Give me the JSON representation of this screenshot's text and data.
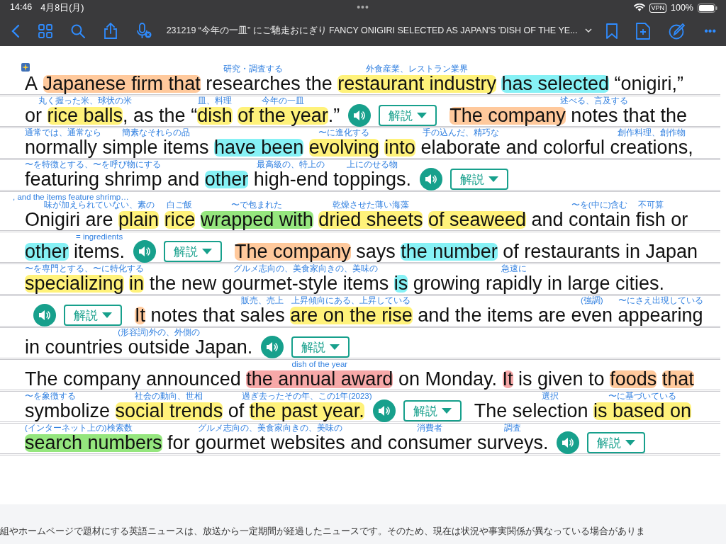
{
  "status_bar": {
    "time": "14:46",
    "date": "4月8日(月)",
    "dots": "•••",
    "vpn": "VPN",
    "battery": "100%"
  },
  "toolbar": {
    "title": "231219 “今年の一皿” にご馳走おにぎり FANCY ONIGIRI SELECTED AS JAPAN'S 'DISH OF THE YE...",
    "more": "•••"
  },
  "lines": [
    {
      "segments": [
        {
          "kind": "text",
          "text": "A "
        },
        {
          "kind": "text",
          "text": "Japanese firm that",
          "color": "#ffc99c"
        },
        {
          "kind": "text",
          "text": " researches",
          "gloss": "研究・調査する"
        },
        {
          "kind": "text",
          "text": " the "
        },
        {
          "kind": "text",
          "text": "restaurant industry",
          "color": "#fff27a",
          "gloss": "外食産業、レストラン業界"
        },
        {
          "kind": "text",
          "text": " has selected",
          "color": "#86f1f5"
        },
        {
          "kind": "text",
          "text": " “onigiri,”"
        }
      ]
    },
    {
      "segments": [
        {
          "kind": "text",
          "text": "or "
        },
        {
          "kind": "text",
          "text": "rice balls",
          "color": "#fff27a",
          "gloss": "丸く握った米、球状の米"
        },
        {
          "kind": "text",
          "text": ", as the “"
        },
        {
          "kind": "text",
          "text": "dish",
          "color": "#fff27a",
          "gloss": "皿、料理"
        },
        {
          "kind": "text",
          "text": " of the year",
          "color": "#fff27a",
          "gloss": "今年の一皿"
        },
        {
          "kind": "text",
          "text": ".”"
        },
        {
          "kind": "audio",
          "label": "解説"
        },
        {
          "kind": "text",
          "text": "The company",
          "color": "#ffc99c"
        },
        {
          "kind": "text",
          "text": " notes",
          "gloss": "述べる、言及する"
        },
        {
          "kind": "text",
          "text": " that the"
        }
      ]
    },
    {
      "segments": [
        {
          "kind": "text",
          "text": "normally",
          "gloss": "通常では、通常なら"
        },
        {
          "kind": "text",
          "text": " simple items",
          "gloss": "簡素なそれらの品"
        },
        {
          "kind": "text",
          "text": " have been",
          "color": "#86f1f5"
        },
        {
          "kind": "text",
          "text": " evolving",
          "color": "#fff27a",
          "gloss": "〜に進化する"
        },
        {
          "kind": "text",
          "text": " into",
          "color": "#fff27a"
        },
        {
          "kind": "text",
          "text": " elaborate",
          "gloss": "手の込んだ、精巧な"
        },
        {
          "kind": "text",
          "text": " and colorful "
        },
        {
          "kind": "text",
          "text": "creations,",
          "gloss": "創作料理、創作物"
        }
      ]
    },
    {
      "segments": [
        {
          "kind": "text",
          "text": "featuring",
          "gloss": "〜を特徴とする、〜を呼び物にする"
        },
        {
          "kind": "text",
          "text": " shrimp and "
        },
        {
          "kind": "text",
          "text": "other",
          "color": "#86f1f5"
        },
        {
          "kind": "text",
          "text": " high-end",
          "gloss": "最高級の、特上の"
        },
        {
          "kind": "text",
          "text": " toppings.",
          "gloss": "上にのせる物"
        },
        {
          "kind": "audio",
          "label": "解説"
        }
      ]
    },
    {
      "note": ", and the items feature shrimp…",
      "segments": [
        {
          "kind": "text",
          "text": "Onigiri "
        },
        {
          "kind": "text",
          "text": "are",
          "gloss": "味が加えられていない、素の"
        },
        {
          "kind": "text",
          "text": " plain",
          "color": "#fff27a"
        },
        {
          "kind": "text",
          "text": " rice",
          "color": "#fff27a",
          "gloss": "白ご飯"
        },
        {
          "kind": "text",
          "text": " wrapped with",
          "color": "#95e67e",
          "gloss": "〜で包まれた"
        },
        {
          "kind": "text",
          "text": " dried sheets",
          "color": "#fff27a",
          "gloss": "乾燥させた薄い海藻"
        },
        {
          "kind": "text",
          "text": " of seaweed",
          "color": "#fff27a"
        },
        {
          "kind": "text",
          "text": " and "
        },
        {
          "kind": "text",
          "text": "contain",
          "gloss": "〜を(中に)含む"
        },
        {
          "kind": "text",
          "text": " fish",
          "gloss": "不可算"
        },
        {
          "kind": "text",
          "text": " or"
        }
      ]
    },
    {
      "segments": [
        {
          "kind": "text",
          "text": "other",
          "color": "#86f1f5"
        },
        {
          "kind": "text",
          "text": " items.",
          "gloss": "= ingredients"
        },
        {
          "kind": "audio",
          "label": "解説"
        },
        {
          "kind": "text",
          "text": "The company",
          "color": "#ffc99c"
        },
        {
          "kind": "text",
          "text": " says "
        },
        {
          "kind": "text",
          "text": "the number",
          "color": "#86f1f5"
        },
        {
          "kind": "text",
          "text": " of restaurants in Japan"
        }
      ]
    },
    {
      "segments": [
        {
          "kind": "text",
          "text": "specializing",
          "color": "#fff27a",
          "gloss": "〜を専門とする、〜に特化する"
        },
        {
          "kind": "text",
          "text": " in",
          "color": "#fff27a"
        },
        {
          "kind": "text",
          "text": " the new "
        },
        {
          "kind": "text",
          "text": "gourmet-style items",
          "gloss": "グルメ志向の、美食家向きの、美味の"
        },
        {
          "kind": "text",
          "text": " is",
          "color": "#86f1f5"
        },
        {
          "kind": "text",
          "text": " growing "
        },
        {
          "kind": "text",
          "text": "rapidly",
          "gloss": "急速に"
        },
        {
          "kind": "text",
          "text": " in large cities."
        }
      ]
    },
    {
      "segments": [
        {
          "kind": "audio",
          "label": "解説"
        },
        {
          "kind": "text",
          "text": "It",
          "color": "#ffc99c"
        },
        {
          "kind": "text",
          "text": " notes that "
        },
        {
          "kind": "text",
          "text": "sales",
          "gloss": "販売、売上"
        },
        {
          "kind": "text",
          "text": " are on the rise",
          "color": "#fff27a",
          "gloss": "上昇傾向にある、上昇している"
        },
        {
          "kind": "text",
          "text": " and the items are "
        },
        {
          "kind": "text",
          "text": "even",
          "gloss": "(強調)"
        },
        {
          "kind": "text",
          "text": " appearing",
          "gloss": "〜にさえ出現している"
        }
      ]
    },
    {
      "segments": [
        {
          "kind": "text",
          "text": "in countries "
        },
        {
          "kind": "text",
          "text": "outside",
          "gloss": "(形容詞)外の、外側の"
        },
        {
          "kind": "text",
          "text": " Japan."
        },
        {
          "kind": "audio",
          "label": "解説"
        }
      ]
    },
    {
      "segments": [
        {
          "kind": "text",
          "text": "The company announced "
        },
        {
          "kind": "text",
          "text": "the annual award",
          "color": "#f7a8a8",
          "gloss": "dish of the year"
        },
        {
          "kind": "text",
          "text": " on Monday. "
        },
        {
          "kind": "text",
          "text": "It",
          "color": "#f7a8a8"
        },
        {
          "kind": "text",
          "text": " is given to "
        },
        {
          "kind": "text",
          "text": "foods",
          "color": "#ffc99c"
        },
        {
          "kind": "text",
          "text": " that",
          "color": "#ffc99c"
        }
      ]
    },
    {
      "segments": [
        {
          "kind": "text",
          "text": "symbolize",
          "gloss": "〜を象徴する"
        },
        {
          "kind": "text",
          "text": " social trends",
          "color": "#fff27a",
          "gloss": "社会の動向、世相"
        },
        {
          "kind": "text",
          "text": " of "
        },
        {
          "kind": "text",
          "text": "the past year.",
          "color": "#fff27a",
          "gloss": "過ぎ去ったその年、この1年(2023)"
        },
        {
          "kind": "audio",
          "label": "解説"
        },
        {
          "kind": "text",
          "text": "The "
        },
        {
          "kind": "text",
          "text": "selection",
          "gloss": "選択"
        },
        {
          "kind": "text",
          "text": " is based on",
          "color": "#fff27a",
          "gloss": "〜に基づいている"
        }
      ]
    },
    {
      "segments": [
        {
          "kind": "text",
          "text": "search numbers",
          "color": "#95e67e",
          "gloss": "(インターネット上の)検索数"
        },
        {
          "kind": "text",
          "text": " for "
        },
        {
          "kind": "text",
          "text": "gourmet websites",
          "gloss": "グルメ志向の、美食家向きの、美味の"
        },
        {
          "kind": "text",
          "text": " and "
        },
        {
          "kind": "text",
          "text": "consumer",
          "gloss": "消費者"
        },
        {
          "kind": "text",
          "text": " surveys.",
          "gloss": "調査"
        },
        {
          "kind": "audio",
          "label": "解説"
        }
      ]
    }
  ],
  "footer": {
    "text": "組やホームページで題材にする英語ニュースは、放送から一定期間が経過したニュースです。そのため、現在は状況や事実関係が異なっている場合がありま"
  }
}
